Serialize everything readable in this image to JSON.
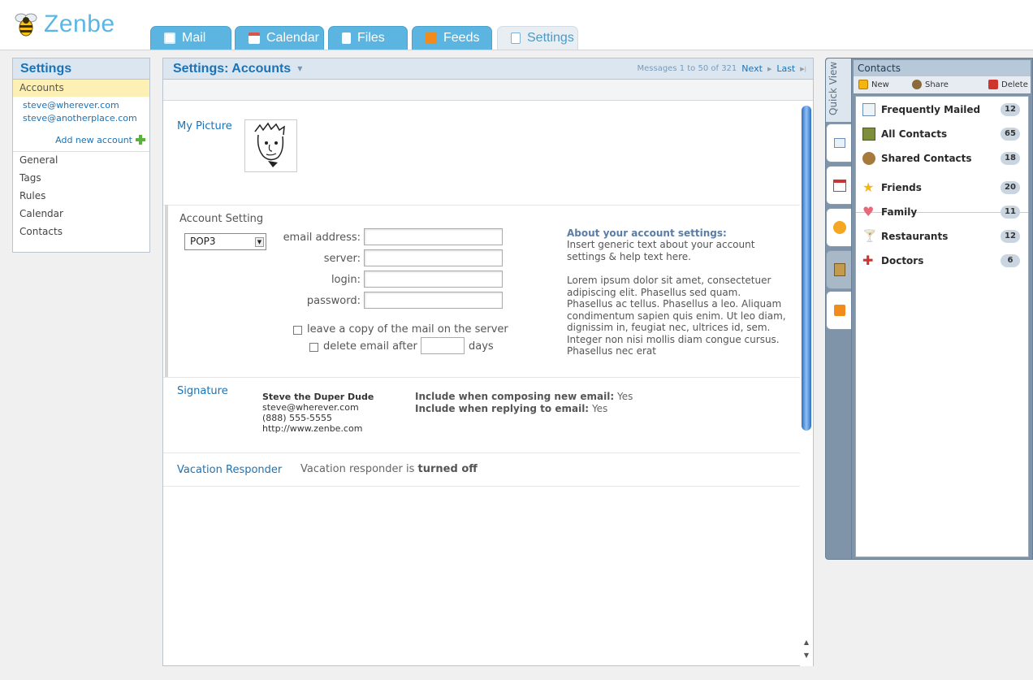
{
  "app": {
    "name": "Zenbe"
  },
  "tabs": [
    {
      "label": "Mail",
      "icon": "mail-icon"
    },
    {
      "label": "Calendar",
      "icon": "calendar-icon"
    },
    {
      "label": "Files",
      "icon": "file-icon"
    },
    {
      "label": "Feeds",
      "icon": "rss-icon"
    },
    {
      "label": "Settings",
      "icon": "settings-icon",
      "active": true
    }
  ],
  "sidebar": {
    "title": "Settings",
    "selected": "Accounts",
    "accounts": [
      "steve@wherever.com",
      "steve@anotherplace.com"
    ],
    "add_account_label": "Add new account",
    "items": [
      "General",
      "Tags",
      "Rules",
      "Calendar",
      "Contacts"
    ]
  },
  "main": {
    "title": "Settings: Accounts",
    "pager": {
      "summary": "Messages 1 to 50 of 321",
      "next_label": "Next",
      "last_label": "Last"
    },
    "picture_label": "My Picture",
    "account_setting": {
      "label": "Account Setting",
      "protocol": "POP3",
      "fields": [
        {
          "label": "email address:",
          "value": ""
        },
        {
          "label": "server:",
          "value": ""
        },
        {
          "label": "login:",
          "value": ""
        },
        {
          "label": "password:",
          "value": ""
        }
      ],
      "leave_copy_label": "leave a copy of the mail on the server",
      "leave_copy_checked": false,
      "delete_after_label": "delete email after",
      "delete_after_checked": false,
      "delete_after_value": "",
      "days_label": "days",
      "about_title": "About your account settings:",
      "about_text": "Insert generic text about your account settings & help text here.",
      "about_lorem": "Lorem ipsum dolor sit amet, consectetuer adipiscing elit. Phasellus sed quam. Phasellus ac tellus. Phasellus a leo. Aliquam condimentum sapien quis enim. Ut leo diam, dignissim in, feugiat nec, ultrices id, sem. Integer non nisi mollis diam congue cursus. Phasellus nec erat"
    },
    "signature": {
      "label": "Signature",
      "name": "Steve the Duper Dude",
      "email": "steve@wherever.com",
      "phone": "(888) 555-5555",
      "url": "http://www.zenbe.com",
      "compose_label": "Include when composing new email:",
      "compose_value": "Yes",
      "reply_label": "Include when replying to email:",
      "reply_value": "Yes"
    },
    "vacation": {
      "label": "Vacation Responder",
      "text": "Vacation responder is",
      "status": "turned off"
    }
  },
  "contacts": {
    "quick_view_label": "Quick View",
    "title": "Contacts",
    "toolbar": {
      "new_label": "New",
      "share_label": "Share",
      "delete_label": "Delete"
    },
    "groups": [
      {
        "label": "Frequently Mailed",
        "count": "12",
        "icon": "envelope-icon"
      },
      {
        "label": "All Contacts",
        "count": "65",
        "icon": "address-book-icon"
      },
      {
        "label": "Shared Contacts",
        "count": "18",
        "icon": "people-icon"
      }
    ],
    "tags": [
      {
        "label": "Friends",
        "count": "20",
        "icon": "star-icon"
      },
      {
        "label": "Family",
        "count": "11",
        "icon": "heart-icon"
      },
      {
        "label": "Restaurants",
        "count": "12",
        "icon": "martini-icon"
      },
      {
        "label": "Doctors",
        "count": "6",
        "icon": "red-cross-icon"
      }
    ]
  },
  "colors": {
    "accent": "#1a73b6",
    "tab": "#5cb4e0",
    "highlight": "#fdf0b5"
  }
}
